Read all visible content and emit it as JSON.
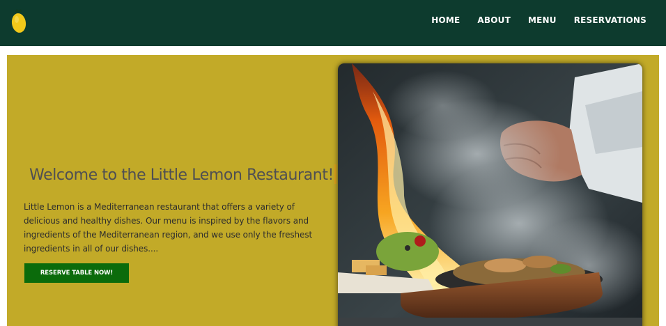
{
  "navbar": {
    "logo_icon": "lemon-icon",
    "links": [
      {
        "label": "HOME"
      },
      {
        "label": "ABOUT"
      },
      {
        "label": "MENU"
      },
      {
        "label": "RESERVATIONS"
      }
    ]
  },
  "hero": {
    "heading": "Welcome to the Little Lemon Restaurant!",
    "description": "Little Lemon is a Mediterranean restaurant that offers a variety of delicious and healthy dishes. Our menu is inspired by the flavors and ingredients of the Mediterranean region, and we use only the freshest ingredients in all of our dishes....",
    "button_label": "RESERVE TABLE NOW!",
    "image": "flaming-sizzling-dish-photo"
  },
  "colors": {
    "navbar_bg": "#0d3b2e",
    "hero_bg": "#c2aa28",
    "button_bg": "#0b6b0b",
    "heading_text": "#4f4f52",
    "lemon_yellow": "#f2c81a"
  }
}
